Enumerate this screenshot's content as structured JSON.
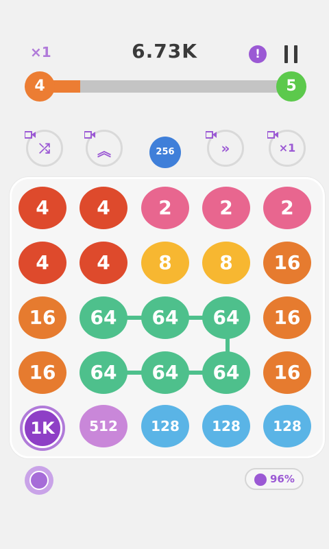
{
  "header": {
    "multiplier": "×1",
    "score": "6.73K",
    "info_icon": "!",
    "pause_icon": "pause-icon"
  },
  "progress": {
    "current_level": "4",
    "next_level": "5",
    "fraction": 0.16,
    "colors": {
      "current": "#ec7d33",
      "next": "#5cc94c",
      "track": "#c4c4c4"
    }
  },
  "powerups": [
    {
      "name": "shuffle",
      "icon": "shuffle-icon",
      "glyph": "⤮",
      "video": true
    },
    {
      "name": "upgrade",
      "icon": "double-up-chevron-icon",
      "glyph": "︽",
      "video": true
    },
    {
      "name": "fast-forward",
      "icon": "double-right-chevron-icon",
      "glyph": "»",
      "video": true
    },
    {
      "name": "multiplier",
      "icon": "times-one-icon",
      "glyph": "×1",
      "video": true
    }
  ],
  "next_tile": {
    "label": "256",
    "color": "#3f7fd9"
  },
  "board": {
    "rows": [
      [
        {
          "label": "4",
          "color": "#de4a2c"
        },
        {
          "label": "4",
          "color": "#de4a2c"
        },
        {
          "label": "2",
          "color": "#e8668f"
        },
        {
          "label": "2",
          "color": "#e8668f"
        },
        {
          "label": "2",
          "color": "#e8668f"
        }
      ],
      [
        {
          "label": "4",
          "color": "#de4a2c"
        },
        {
          "label": "4",
          "color": "#de4a2c"
        },
        {
          "label": "8",
          "color": "#f7b731"
        },
        {
          "label": "8",
          "color": "#f7b731"
        },
        {
          "label": "16",
          "color": "#e67b2f"
        }
      ],
      [
        {
          "label": "16",
          "color": "#e67b2f"
        },
        {
          "label": "64",
          "color": "#4ec08c"
        },
        {
          "label": "64",
          "color": "#4ec08c"
        },
        {
          "label": "64",
          "color": "#4ec08c"
        },
        {
          "label": "16",
          "color": "#e67b2f"
        }
      ],
      [
        {
          "label": "16",
          "color": "#e67b2f"
        },
        {
          "label": "64",
          "color": "#4ec08c"
        },
        {
          "label": "64",
          "color": "#4ec08c"
        },
        {
          "label": "64",
          "color": "#4ec08c"
        },
        {
          "label": "16",
          "color": "#e67b2f"
        }
      ],
      [
        {
          "label": "1K",
          "color": "#8e3fc6",
          "special": true
        },
        {
          "label": "512",
          "color": "#c987d9"
        },
        {
          "label": "128",
          "color": "#5ab4e6"
        },
        {
          "label": "128",
          "color": "#5ab4e6"
        },
        {
          "label": "128",
          "color": "#5ab4e6"
        }
      ]
    ]
  },
  "footer": {
    "left_icon": "radar-icon",
    "percent": "96%",
    "percent_icon": "globe-icon"
  }
}
